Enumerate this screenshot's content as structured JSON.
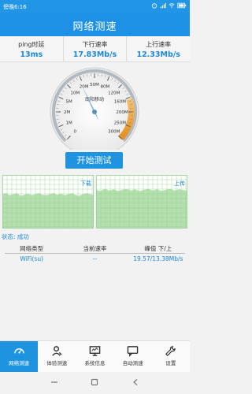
{
  "status_bar": {
    "time": "傍晚6:16",
    "icons": [
      "alarm-icon",
      "signal-icon",
      "wifi-icon",
      "battery-icon"
    ]
  },
  "app": {
    "title": "网络测速"
  },
  "metrics": [
    {
      "label": "ping时延",
      "value": "13ms"
    },
    {
      "label": "下行速率",
      "value": "17.83Mb/s"
    },
    {
      "label": "上行速率",
      "value": "12.33Mb/s"
    }
  ],
  "gauge": {
    "ticks": [
      "0",
      "1M",
      "2M",
      "5M",
      "10M",
      "20M",
      "50M",
      "80M",
      "120M",
      "160M",
      "200M",
      "250M",
      "300M"
    ],
    "center_label": "南阳移动",
    "max": 300,
    "needle_value": 20
  },
  "start_button": {
    "label": "开始测试"
  },
  "graphs": {
    "download_label": "下载",
    "upload_label": "上传",
    "download_fill": [
      0.65,
      0.66,
      0.62,
      0.64,
      0.66,
      0.61,
      0.63,
      0.65,
      0.62,
      0.64,
      0.66,
      0.63,
      0.62,
      0.64,
      0.66,
      0.63,
      0.65,
      0.62,
      0.64,
      0.66,
      0.63,
      0.61,
      0.64,
      0.66,
      0.64,
      0.62
    ],
    "upload_fill": [
      0.72,
      0.7,
      0.74,
      0.71,
      0.73,
      0.7,
      0.72,
      0.74,
      0.71,
      0.73,
      0.7,
      0.72,
      0.74,
      0.71,
      0.73,
      0.7,
      0.72,
      0.74,
      0.71,
      0.73,
      0.72,
      0.7
    ]
  },
  "status": {
    "text": "状态: 成功"
  },
  "info": {
    "headers": [
      "网络类型",
      "当前速率",
      "峰值 下/上"
    ],
    "values": [
      "WiFi(su)",
      "--",
      "19.57/13.38Mb/s"
    ]
  },
  "tabs": [
    {
      "label": "网络测速",
      "icon": "speedometer-icon",
      "active": true
    },
    {
      "label": "体验测速",
      "icon": "person-icon",
      "active": false
    },
    {
      "label": "系统信息",
      "icon": "monitor-icon",
      "active": false
    },
    {
      "label": "自动测速",
      "icon": "chat-icon",
      "active": false
    },
    {
      "label": "设置",
      "icon": "wrench-icon",
      "active": false
    }
  ],
  "nav": [
    "menu-icon",
    "home-icon",
    "back-icon"
  ],
  "colors": {
    "primary": "#1e90e6",
    "accent_orange": "#f0a030",
    "graph_green": "#a8d8a0"
  }
}
